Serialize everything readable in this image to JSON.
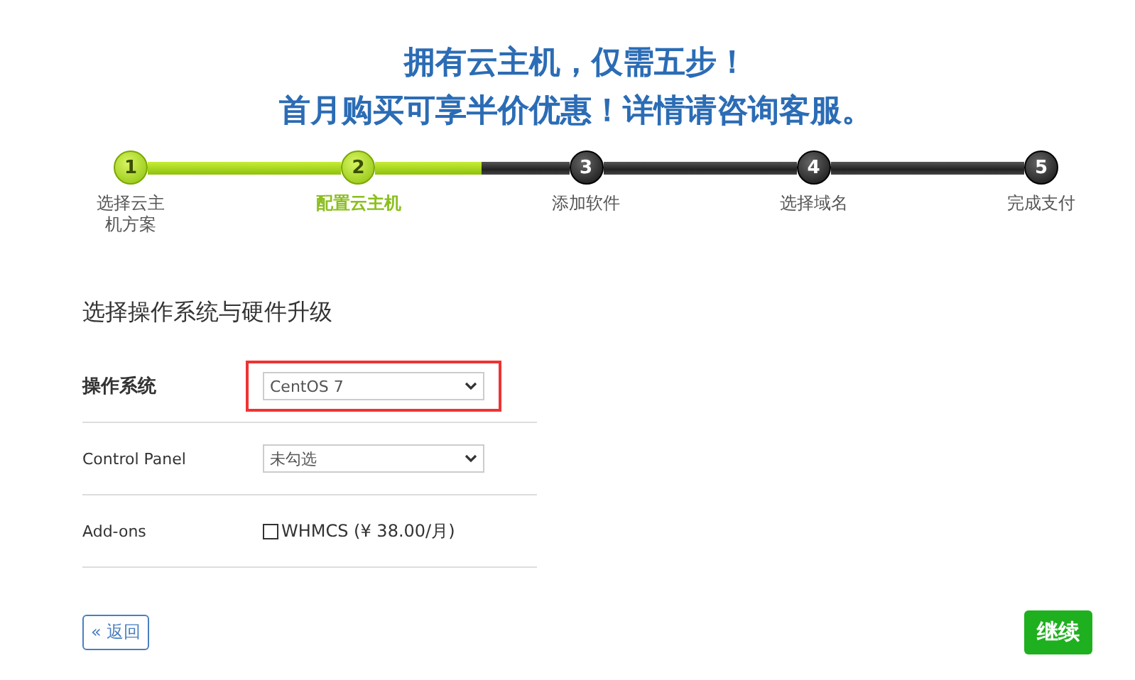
{
  "headline": [
    "拥有云主机，仅需五步！",
    "首月购买可享半价优惠！详情请咨询客服。"
  ],
  "steps": [
    {
      "number": "1",
      "label": "选择云主机方案",
      "reached": true,
      "selected": false
    },
    {
      "number": "2",
      "label": "配置云主机",
      "reached": true,
      "selected": true
    },
    {
      "number": "3",
      "label": "添加软件",
      "reached": false,
      "selected": false
    },
    {
      "number": "4",
      "label": "选择域名",
      "reached": false,
      "selected": false
    },
    {
      "number": "5",
      "label": "完成支付",
      "reached": false,
      "selected": false
    }
  ],
  "connectors": [
    {
      "level": 1
    },
    {
      "level": 0.55
    },
    {
      "level": 0
    },
    {
      "level": 0
    }
  ],
  "section_title": "选择操作系统与硬件升级",
  "form_rows": [
    {
      "kind": "select",
      "label": "操作系统",
      "label_bold": true,
      "value": "CentOS 7",
      "highlighted": true
    },
    {
      "kind": "select",
      "label": "Control Panel",
      "label_bold": false,
      "value": "未勾选",
      "highlighted": false
    },
    {
      "kind": "checkbox",
      "label": "Add-ons",
      "label_bold": false,
      "option": "WHMCS (¥ 38.00/月)",
      "checked": false
    }
  ],
  "back_button": "« 返回",
  "continue_button": "继续"
}
